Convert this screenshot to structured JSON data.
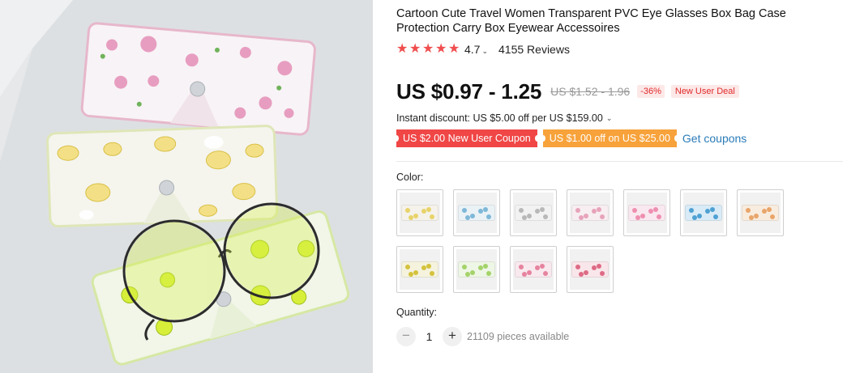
{
  "product": {
    "title": "Cartoon Cute Travel Women Transparent PVC Eye Glasses Box Bag Case Protection Carry Box Eyewear Accessoires",
    "rating": "4.7",
    "reviews": "4155 Reviews",
    "stars_filled": 5
  },
  "price": {
    "current": "US $0.97 - 1.25",
    "original": "US $1.52 - 1.96",
    "discount": "-36%",
    "deal": "New User Deal"
  },
  "promo": {
    "instant_discount": "Instant discount: US $5.00 off per US $159.00",
    "coupon_new_user": "US $2.00 New User Coupon",
    "coupon_off": "US $1.00 off on US $25.00",
    "get_coupons": "Get coupons"
  },
  "color": {
    "label": "Color:",
    "options": [
      {
        "name": "lemon-white",
        "bg": "#f4f2ea",
        "accent": "#e8d36a"
      },
      {
        "name": "blue-flower",
        "bg": "#eaf2f6",
        "accent": "#7fb8d8"
      },
      {
        "name": "clear-gray",
        "bg": "#f2f2f2",
        "accent": "#b8b8b8"
      },
      {
        "name": "pink-dots",
        "bg": "#f7eef2",
        "accent": "#e7a3bb"
      },
      {
        "name": "pink-fruit",
        "bg": "#f9e8ef",
        "accent": "#ef8fb0"
      },
      {
        "name": "blue-pattern",
        "bg": "#d9ebf6",
        "accent": "#4fa1d4"
      },
      {
        "name": "orange-pattern",
        "bg": "#f8ecdf",
        "accent": "#e9a56a"
      },
      {
        "name": "yellow-pear",
        "bg": "#f5f3de",
        "accent": "#d4c23d"
      },
      {
        "name": "green-pear",
        "bg": "#eef6e6",
        "accent": "#a4d36a"
      },
      {
        "name": "pink-cartoon",
        "bg": "#f8e9ee",
        "accent": "#e6839f"
      },
      {
        "name": "pink-strawberry",
        "bg": "#f9e6ea",
        "accent": "#de6b85"
      }
    ]
  },
  "quantity": {
    "label": "Quantity:",
    "value": "1",
    "available": "21109 pieces available",
    "minus_icon": "minus-icon",
    "plus_icon": "plus-icon"
  },
  "colors": {
    "star": "#f04e4e",
    "coupon_red": "#f04646",
    "coupon_orange": "#f7a23a",
    "link": "#2a7bb8"
  }
}
